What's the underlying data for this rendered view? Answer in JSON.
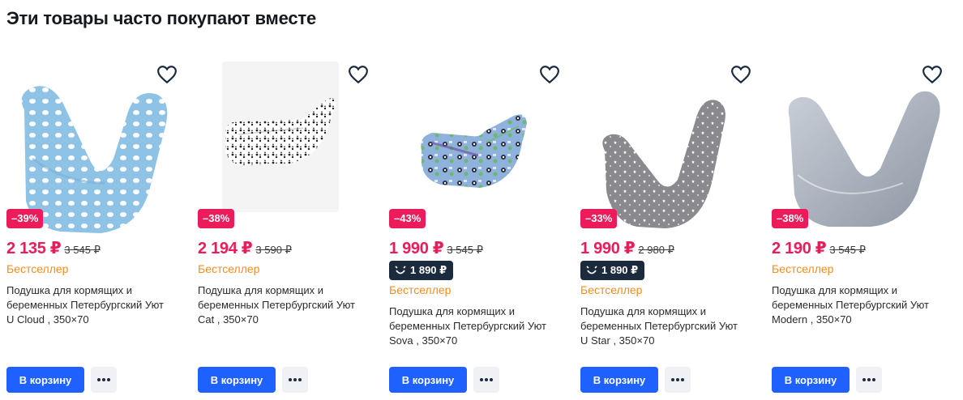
{
  "section": {
    "title": "Эти товары часто покупают вместе"
  },
  "colors": {
    "accent": "#1f61ff",
    "sale": "#ec1c5b",
    "badge": "#f58c1e",
    "club": "#1b2a3d"
  },
  "products": [
    {
      "discount": "–39%",
      "price": "2 135 ₽",
      "old_price": "3 545 ₽",
      "club_price": "",
      "badge": "Бестселлер",
      "title_line1": "Подушка для кормящих и",
      "title_line2": "беременных Петербургский Уют",
      "title_line3": "U Cloud , 350×70",
      "buy_label": "В корзину",
      "image_icon": "pillow-u-cloud-image"
    },
    {
      "discount": "–38%",
      "price": "2 194 ₽",
      "old_price": "3 590 ₽",
      "club_price": "",
      "badge": "Бестселлер",
      "title_line1": "Подушка для кормящих и",
      "title_line2": "беременных Петербургский Уют",
      "title_line3": "Cat , 350×70",
      "buy_label": "В корзину",
      "image_icon": "pillow-cat-image"
    },
    {
      "discount": "–43%",
      "price": "1 990 ₽",
      "old_price": "3 545 ₽",
      "club_price": "1 890 ₽",
      "badge": "Бестселлер",
      "title_line1": "Подушка для кормящих и",
      "title_line2": "беременных Петербургский Уют",
      "title_line3": "Sova , 350×70",
      "buy_label": "В корзину",
      "image_icon": "pillow-sova-image"
    },
    {
      "discount": "–33%",
      "price": "1 990 ₽",
      "old_price": "2 980 ₽",
      "club_price": "1 890 ₽",
      "badge": "Бестселлер",
      "title_line1": "Подушка для кормящих и",
      "title_line2": "беременных Петербургский Уют",
      "title_line3": "U Star , 350×70",
      "buy_label": "В корзину",
      "image_icon": "pillow-u-star-image"
    },
    {
      "discount": "–38%",
      "price": "2 190 ₽",
      "old_price": "3 545 ₽",
      "club_price": "",
      "badge": "Бестселлер",
      "title_line1": "Подушка для кормящих и",
      "title_line2": "беременных Петербургский Уют",
      "title_line3": "Modern , 350×70",
      "buy_label": "В корзину",
      "image_icon": "pillow-modern-image"
    }
  ]
}
